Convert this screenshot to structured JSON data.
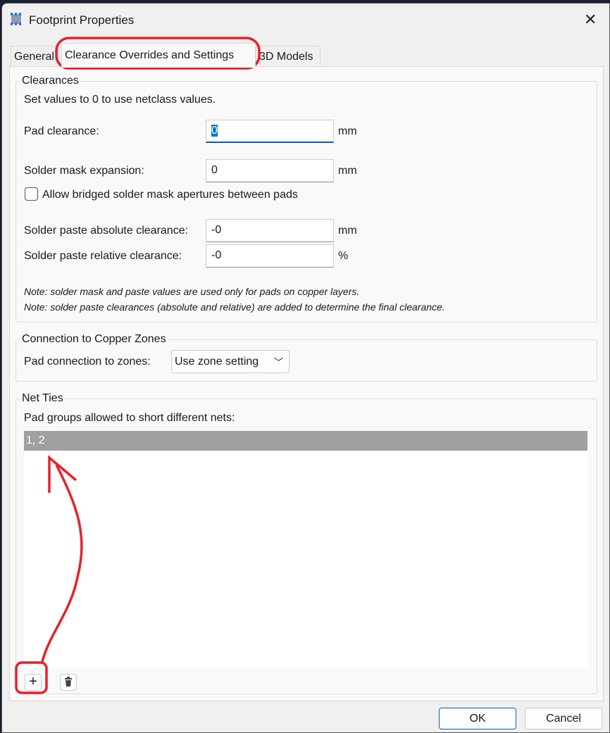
{
  "window": {
    "title": "Footprint Properties",
    "close_icon": "close-icon",
    "app_icon": "footprint-icon"
  },
  "tabs": [
    {
      "label": "General"
    },
    {
      "label": "Clearance Overrides and Settings",
      "active": true
    },
    {
      "label": "3D Models"
    }
  ],
  "clearances": {
    "title": "Clearances",
    "hint": "Set values to 0 to use netclass values.",
    "pad_clearance": {
      "label": "Pad clearance:",
      "value": "0",
      "unit": "mm"
    },
    "solder_mask": {
      "label": "Solder mask expansion:",
      "value": "0",
      "unit": "mm"
    },
    "bridged_checkbox": {
      "label": "Allow bridged solder mask apertures between pads",
      "checked": false
    },
    "paste_abs": {
      "label": "Solder paste absolute clearance:",
      "value": "-0",
      "unit": "mm"
    },
    "paste_rel": {
      "label": "Solder paste relative clearance:",
      "value": "-0",
      "unit": "%"
    },
    "note1": "Note: solder mask and paste values are used only for pads on copper layers.",
    "note2": "Note: solder paste clearances (absolute and relative) are added to determine the final clearance."
  },
  "zones": {
    "title": "Connection to Copper Zones",
    "label": "Pad connection to zones:",
    "value": "Use zone setting"
  },
  "net_ties": {
    "title": "Net Ties",
    "label": "Pad groups allowed to short different nets:",
    "rows": [
      "1, 2"
    ],
    "add_icon": "plus-icon",
    "delete_icon": "trash-icon"
  },
  "buttons": {
    "ok": "OK",
    "cancel": "Cancel"
  },
  "annotation_color": "#e8202a"
}
